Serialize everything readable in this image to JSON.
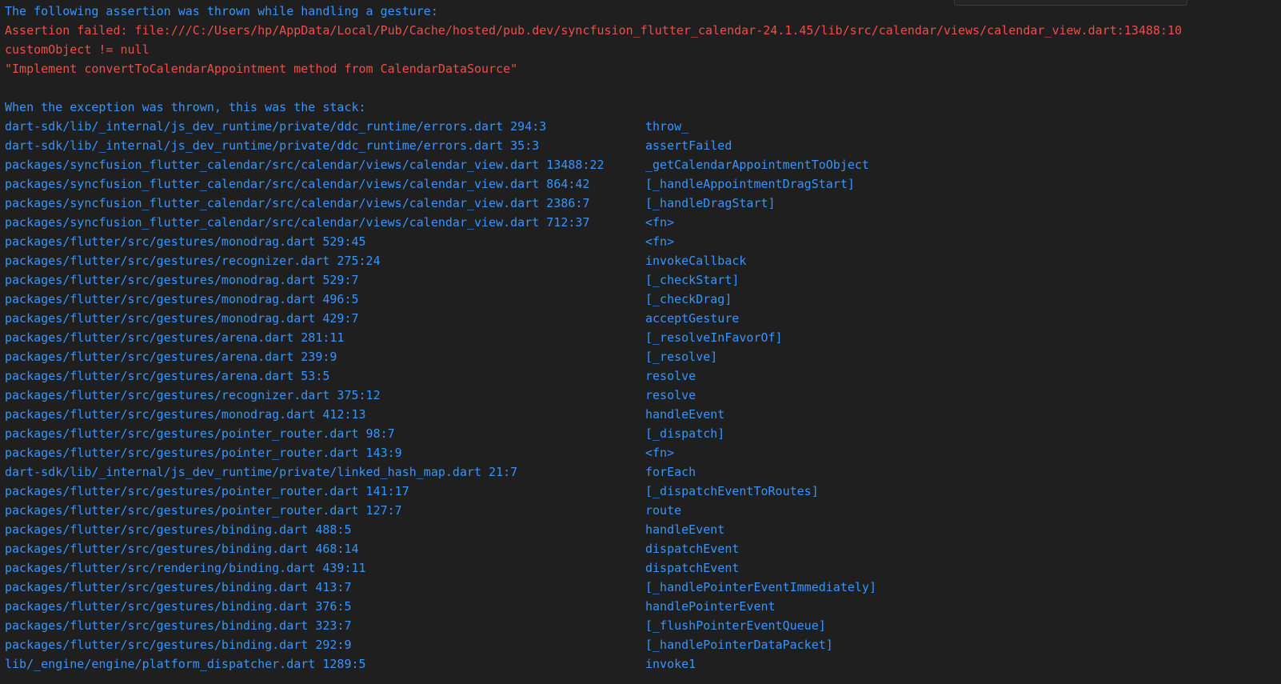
{
  "header": {
    "line1": "The following assertion was thrown while handling a gesture:",
    "line2": "Assertion failed: file:///C:/Users/hp/AppData/Local/Pub/Cache/hosted/pub.dev/syncfusion_flutter_calendar-24.1.45/lib/src/calendar/views/calendar_view.dart:13488:10",
    "line3": "customObject != null",
    "line4": "\"Implement convertToCalendarAppointment method from CalendarDataSource\"",
    "line5": "When the exception was thrown, this was the stack:"
  },
  "colors": {
    "info": "#3794ff",
    "error": "#f14c4c",
    "background": "#1f1f1f"
  },
  "stack": [
    {
      "loc": "dart-sdk/lib/_internal/js_dev_runtime/private/ddc_runtime/errors.dart 294:3",
      "fn": "throw_"
    },
    {
      "loc": "dart-sdk/lib/_internal/js_dev_runtime/private/ddc_runtime/errors.dart 35:3",
      "fn": "assertFailed"
    },
    {
      "loc": "packages/syncfusion_flutter_calendar/src/calendar/views/calendar_view.dart 13488:22",
      "fn": "_getCalendarAppointmentToObject"
    },
    {
      "loc": "packages/syncfusion_flutter_calendar/src/calendar/views/calendar_view.dart 864:42",
      "fn": "[_handleAppointmentDragStart]"
    },
    {
      "loc": "packages/syncfusion_flutter_calendar/src/calendar/views/calendar_view.dart 2386:7",
      "fn": "[_handleDragStart]"
    },
    {
      "loc": "packages/syncfusion_flutter_calendar/src/calendar/views/calendar_view.dart 712:37",
      "fn": "<fn>"
    },
    {
      "loc": "packages/flutter/src/gestures/monodrag.dart 529:45",
      "fn": "<fn>"
    },
    {
      "loc": "packages/flutter/src/gestures/recognizer.dart 275:24",
      "fn": "invokeCallback"
    },
    {
      "loc": "packages/flutter/src/gestures/monodrag.dart 529:7",
      "fn": "[_checkStart]"
    },
    {
      "loc": "packages/flutter/src/gestures/monodrag.dart 496:5",
      "fn": "[_checkDrag]"
    },
    {
      "loc": "packages/flutter/src/gestures/monodrag.dart 429:7",
      "fn": "acceptGesture"
    },
    {
      "loc": "packages/flutter/src/gestures/arena.dart 281:11",
      "fn": "[_resolveInFavorOf]"
    },
    {
      "loc": "packages/flutter/src/gestures/arena.dart 239:9",
      "fn": "[_resolve]"
    },
    {
      "loc": "packages/flutter/src/gestures/arena.dart 53:5",
      "fn": "resolve"
    },
    {
      "loc": "packages/flutter/src/gestures/recognizer.dart 375:12",
      "fn": "resolve"
    },
    {
      "loc": "packages/flutter/src/gestures/monodrag.dart 412:13",
      "fn": "handleEvent"
    },
    {
      "loc": "packages/flutter/src/gestures/pointer_router.dart 98:7",
      "fn": "[_dispatch]"
    },
    {
      "loc": "packages/flutter/src/gestures/pointer_router.dart 143:9",
      "fn": "<fn>"
    },
    {
      "loc": "dart-sdk/lib/_internal/js_dev_runtime/private/linked_hash_map.dart 21:7",
      "fn": "forEach"
    },
    {
      "loc": "packages/flutter/src/gestures/pointer_router.dart 141:17",
      "fn": "[_dispatchEventToRoutes]"
    },
    {
      "loc": "packages/flutter/src/gestures/pointer_router.dart 127:7",
      "fn": "route"
    },
    {
      "loc": "packages/flutter/src/gestures/binding.dart 488:5",
      "fn": "handleEvent"
    },
    {
      "loc": "packages/flutter/src/gestures/binding.dart 468:14",
      "fn": "dispatchEvent"
    },
    {
      "loc": "packages/flutter/src/rendering/binding.dart 439:11",
      "fn": "dispatchEvent"
    },
    {
      "loc": "packages/flutter/src/gestures/binding.dart 413:7",
      "fn": "[_handlePointerEventImmediately]"
    },
    {
      "loc": "packages/flutter/src/gestures/binding.dart 376:5",
      "fn": "handlePointerEvent"
    },
    {
      "loc": "packages/flutter/src/gestures/binding.dart 323:7",
      "fn": "[_flushPointerEventQueue]"
    },
    {
      "loc": "packages/flutter/src/gestures/binding.dart 292:9",
      "fn": "[_handlePointerDataPacket]"
    },
    {
      "loc": "lib/_engine/engine/platform_dispatcher.dart 1289:5",
      "fn": "invoke1"
    }
  ]
}
